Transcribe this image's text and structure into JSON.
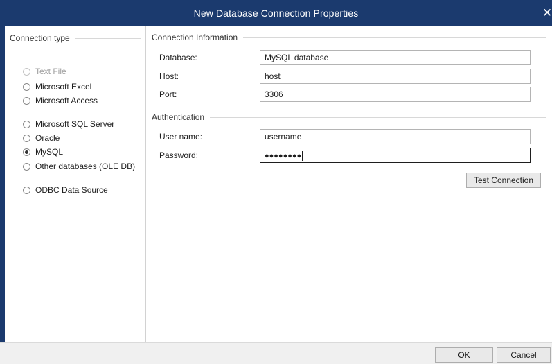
{
  "window": {
    "title": "New Database Connection Properties",
    "close_glyph": "✕",
    "accent_color": "#1b3a6e"
  },
  "connection_type": {
    "header": "Connection type",
    "options": [
      {
        "label": "Text File",
        "checked": false,
        "disabled": true
      },
      {
        "label": "Microsoft Excel",
        "checked": false,
        "disabled": false
      },
      {
        "label": "Microsoft Access",
        "checked": false,
        "disabled": false
      },
      {
        "label": "Microsoft SQL Server",
        "checked": false,
        "disabled": false
      },
      {
        "label": "Oracle",
        "checked": false,
        "disabled": false
      },
      {
        "label": "MySQL",
        "checked": true,
        "disabled": false
      },
      {
        "label": "Other databases (OLE DB)",
        "checked": false,
        "disabled": false
      },
      {
        "label": "ODBC Data Source",
        "checked": false,
        "disabled": false
      }
    ]
  },
  "connection_info": {
    "header": "Connection Information",
    "database_label": "Database:",
    "database_value": "MySQL database",
    "host_label": "Host:",
    "host_value": "host",
    "port_label": "Port:",
    "port_value": "3306"
  },
  "authentication": {
    "header": "Authentication",
    "username_label": "User name:",
    "username_value": "username",
    "password_label": "Password:",
    "password_masked": "●●●●●●●●"
  },
  "buttons": {
    "test_connection": "Test Connection",
    "ok": "OK",
    "cancel": "Cancel"
  }
}
